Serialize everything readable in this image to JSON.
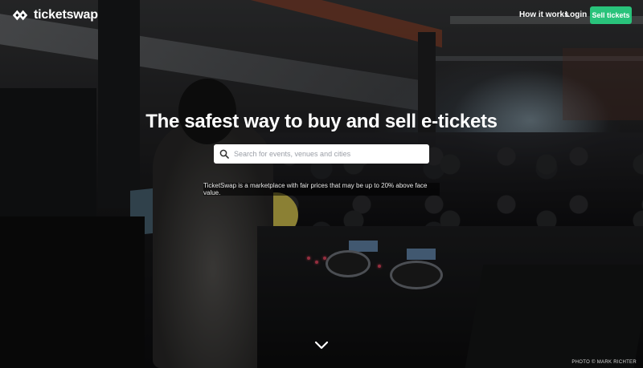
{
  "brand": {
    "name": "ticketswap"
  },
  "nav": {
    "how_it_works": "How it works",
    "login": "Login",
    "sell_tickets": "Sell tickets",
    "sell_button_color": "#29c37b"
  },
  "hero": {
    "headline": "The safest way to buy and sell e-tickets",
    "search_placeholder": "Search for events, venues and cities",
    "subtitle": "TicketSwap is a marketplace with fair prices that may be up to 20% above face value.",
    "photo_credit": "PHOTO © MARK RICHTER",
    "scroll_icon": "chevron-down-icon"
  }
}
